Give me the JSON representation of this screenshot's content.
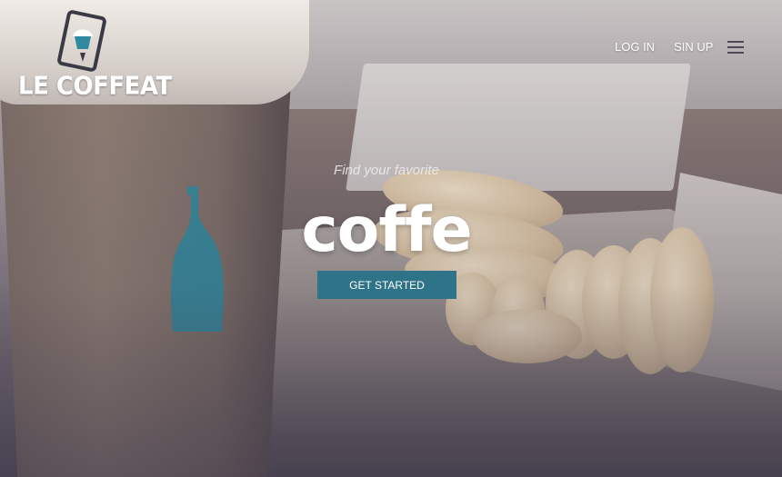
{
  "brand": {
    "name": "LE COFFEAT",
    "icon": "cupcake-phone-icon"
  },
  "nav": {
    "links": [
      {
        "label": "LOG IN"
      },
      {
        "label": "SIN UP"
      }
    ],
    "menu_icon": "hamburger-menu-icon"
  },
  "hero": {
    "tagline": "Find your favorite",
    "headline": "coffe",
    "cta_label": "GET STARTED"
  },
  "colors": {
    "accent": "#2e7388",
    "text": "#ffffff"
  }
}
